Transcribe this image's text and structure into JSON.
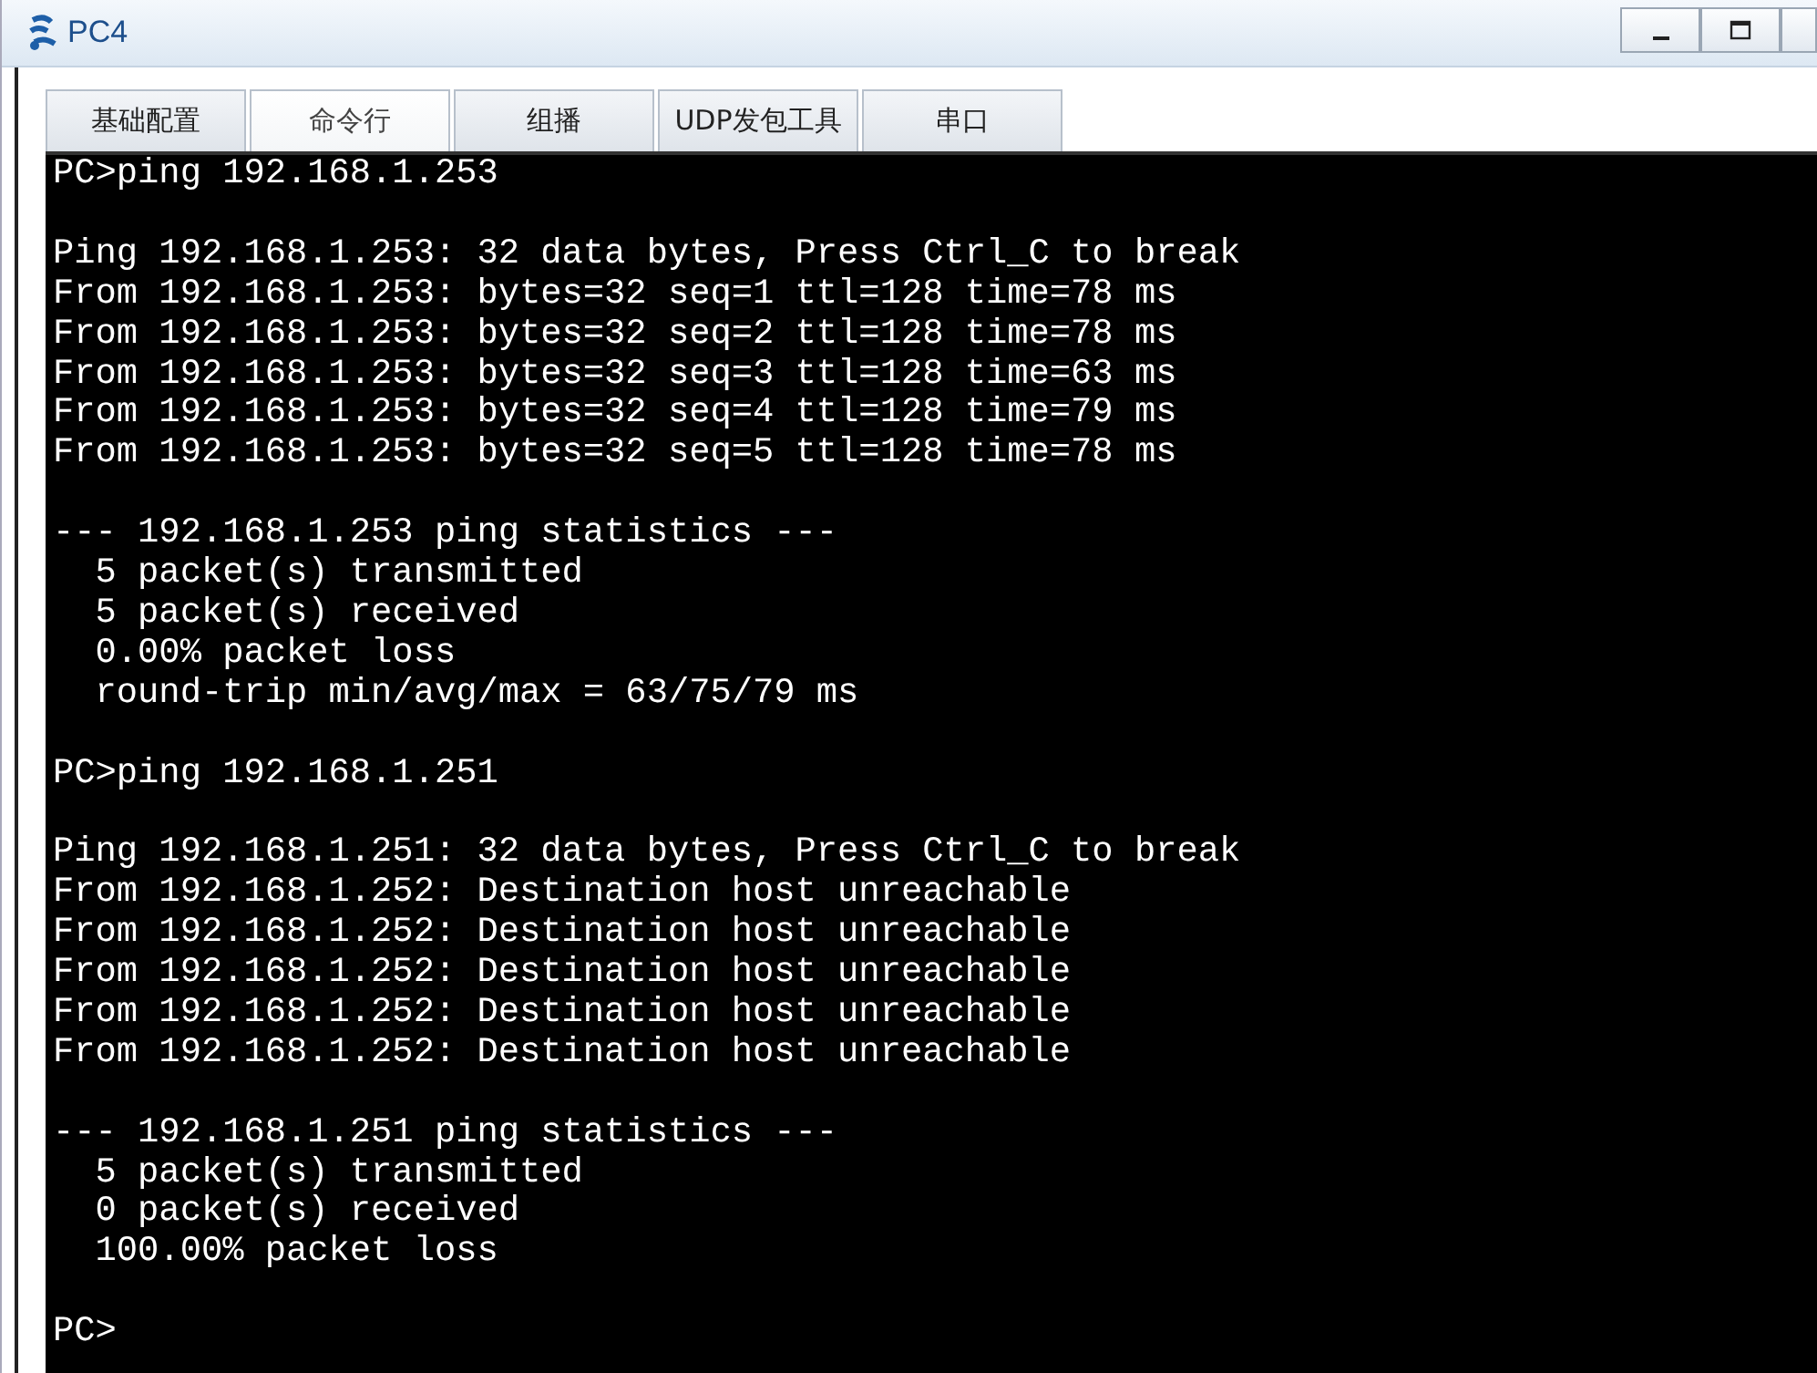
{
  "window": {
    "title": "PC4"
  },
  "tabs": [
    {
      "label": "基础配置",
      "selected": false
    },
    {
      "label": "命令行",
      "selected": true
    },
    {
      "label": "组播",
      "selected": false
    },
    {
      "label": "UDP发包工具",
      "selected": false
    },
    {
      "label": "串口",
      "selected": false
    }
  ],
  "console": {
    "blocks": [
      [
        "PC>ping 192.168.1.253"
      ],
      [
        "Ping 192.168.1.253: 32 data bytes, Press Ctrl_C to break",
        "From 192.168.1.253: bytes=32 seq=1 ttl=128 time=78 ms",
        "From 192.168.1.253: bytes=32 seq=2 ttl=128 time=78 ms",
        "From 192.168.1.253: bytes=32 seq=3 ttl=128 time=63 ms",
        "From 192.168.1.253: bytes=32 seq=4 ttl=128 time=79 ms",
        "From 192.168.1.253: bytes=32 seq=5 ttl=128 time=78 ms"
      ],
      [
        "--- 192.168.1.253 ping statistics ---",
        "  5 packet(s) transmitted",
        "  5 packet(s) received",
        "  0.00% packet loss",
        "  round-trip min/avg/max = 63/75/79 ms"
      ],
      [
        "PC>ping 192.168.1.251"
      ],
      [
        "Ping 192.168.1.251: 32 data bytes, Press Ctrl_C to break",
        "From 192.168.1.252: Destination host unreachable",
        "From 192.168.1.252: Destination host unreachable",
        "From 192.168.1.252: Destination host unreachable",
        "From 192.168.1.252: Destination host unreachable",
        "From 192.168.1.252: Destination host unreachable"
      ],
      [
        "--- 192.168.1.251 ping statistics ---",
        "  5 packet(s) transmitted",
        "  0 packet(s) received",
        "  100.00% packet loss"
      ],
      [
        "PC>"
      ]
    ]
  }
}
